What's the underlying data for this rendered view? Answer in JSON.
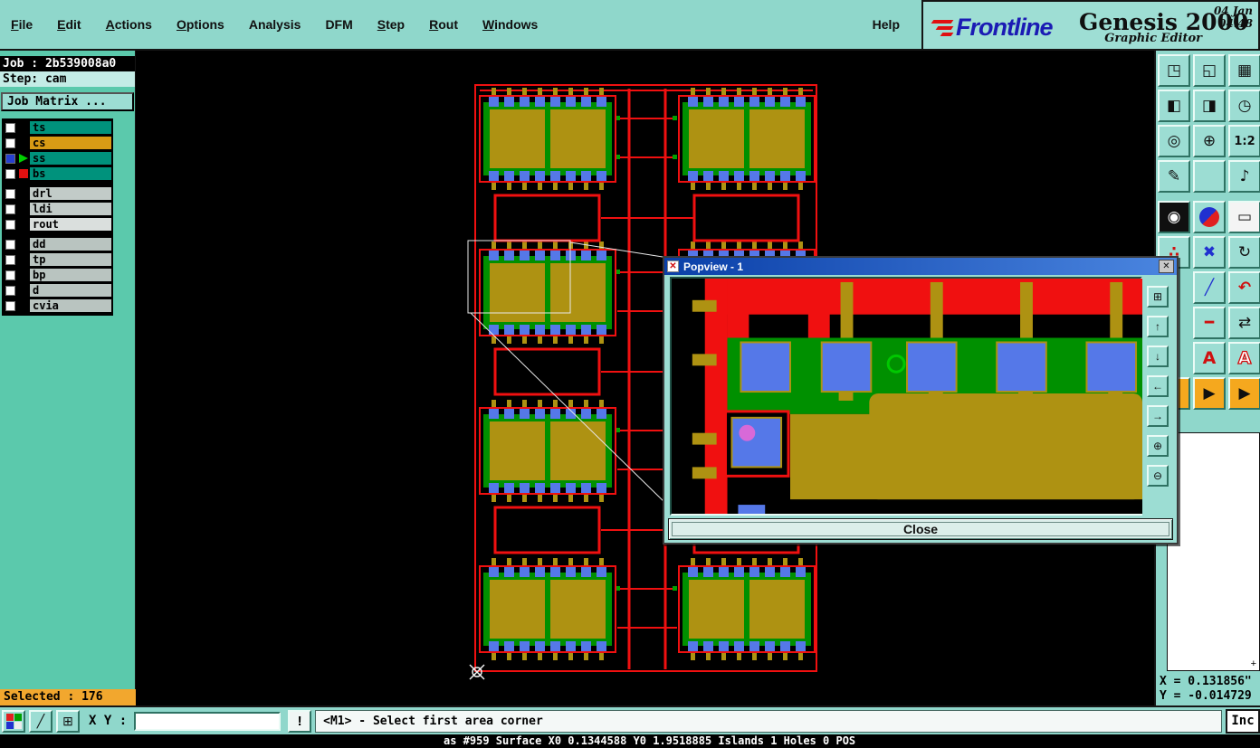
{
  "app": {
    "logo": "Frontline",
    "product": "Genesis 2000",
    "date": "04 Jan",
    "time": "04:48",
    "subtitle": "Graphic Editor"
  },
  "menubar": {
    "items": [
      {
        "label": "File"
      },
      {
        "label": "Edit"
      },
      {
        "label": "Actions"
      },
      {
        "label": "Options"
      },
      {
        "label": "Analysis"
      },
      {
        "label": "DFM"
      },
      {
        "label": "Step"
      },
      {
        "label": "Rout"
      },
      {
        "label": "Windows"
      }
    ],
    "help": "Help"
  },
  "sidebar": {
    "job": "Job : 2b539008a0",
    "step": "Step: cam",
    "job_matrix": "Job Matrix ...",
    "selected": "Selected : 176",
    "layers": [
      {
        "name": "ts",
        "row_color": "#00927C"
      },
      {
        "name": "cs",
        "row_color": "#D89B15"
      },
      {
        "name": "ss",
        "row_color": "#00927C"
      },
      {
        "name": "bs",
        "row_color": "#00927C"
      },
      {
        "name": "drl",
        "row_color": "#C2CBC8"
      },
      {
        "name": "ldi",
        "row_color": "#C2CBC8"
      },
      {
        "name": "rout",
        "row_color": "#DADFDD"
      },
      {
        "name": "dd",
        "row_color": "#B9C4C0"
      },
      {
        "name": "tp",
        "row_color": "#B9C4C0"
      },
      {
        "name": "bp",
        "row_color": "#B9C4C0"
      },
      {
        "name": "d",
        "row_color": "#B9C4C0"
      },
      {
        "name": "cvia",
        "row_color": "#B9C4C0"
      }
    ]
  },
  "popview": {
    "title": "Popview - 1",
    "close_x": "✕",
    "close_button": "Close",
    "side_buttons": [
      {
        "name": "view-window",
        "glyph": "⊞"
      },
      {
        "name": "pan-up",
        "glyph": "↑"
      },
      {
        "name": "pan-down",
        "glyph": "↓"
      },
      {
        "name": "pan-left",
        "glyph": "←"
      },
      {
        "name": "pan-right",
        "glyph": "→"
      },
      {
        "name": "zoom-in",
        "glyph": "⊕"
      },
      {
        "name": "zoom-out",
        "glyph": "⊖"
      }
    ]
  },
  "right_panel": {
    "top_buttons": [
      {
        "name": "window-raise",
        "glyph": "◳"
      },
      {
        "name": "window-lower",
        "glyph": "◱"
      },
      {
        "name": "window-tile",
        "glyph": "▦"
      },
      {
        "name": "window-left",
        "glyph": "◧"
      },
      {
        "name": "window-right",
        "glyph": "◨"
      },
      {
        "name": "history-clock",
        "glyph": "◷"
      },
      {
        "name": "zoom-reset",
        "glyph": "◎"
      },
      {
        "name": "zoom-point",
        "glyph": "⊕"
      },
      {
        "name": "zoom-ratio",
        "glyph": "1:2"
      },
      {
        "name": "edit-pencil",
        "glyph": "✎"
      },
      {
        "name": "spacer",
        "glyph": ""
      },
      {
        "name": "notes",
        "glyph": "♪"
      }
    ],
    "mid_buttons": [
      {
        "name": "origin-mark",
        "glyph": "◉"
      },
      {
        "name": "layer-pie",
        "glyph": ""
      },
      {
        "name": "ruler",
        "glyph": "▭"
      },
      {
        "name": "snap-points",
        "glyph": "∴"
      },
      {
        "name": "delete",
        "glyph": "✖"
      },
      {
        "name": "rotate",
        "glyph": "↻"
      },
      {
        "name": "line-draw",
        "glyph": "╱"
      },
      {
        "name": "arc-draw",
        "glyph": "↶"
      },
      {
        "name": "slot-draw",
        "glyph": "━"
      },
      {
        "name": "transform",
        "glyph": "⇄"
      },
      {
        "name": "text-filled",
        "glyph": "A"
      },
      {
        "name": "text-outline",
        "glyph": "A"
      },
      {
        "name": "select-a",
        "glyph": "▶"
      },
      {
        "name": "select-b",
        "glyph": "▶"
      }
    ],
    "coords": {
      "x": "X = 0.131856\"",
      "y": "Y = -0.014729"
    }
  },
  "statusbar": {
    "xy_label": "X Y :",
    "input_value": "",
    "alert": "!",
    "message": "<M1> - Select first area corner",
    "inc": "Inc"
  },
  "bottom_status": "as #959 Surface X0 0.1344588 Y0 1.9518885 Islands 1 Holes 0 POS"
}
